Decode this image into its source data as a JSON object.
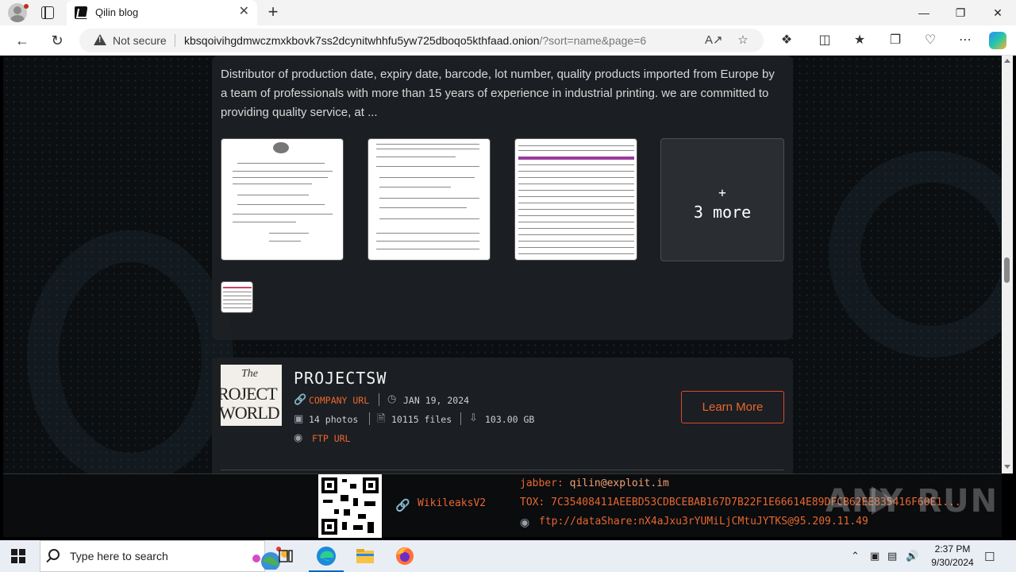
{
  "browser": {
    "tab_title": "Qilin blog",
    "security_label": "Not secure",
    "url_host": "kbsqoivihgdmwczmxkbovk7ss2dcynitwhhfu5yw725dboqo5kthfaad.onion",
    "url_rest": "/?sort=name&page=6",
    "tab_close": "✕",
    "newtab": "+",
    "window": {
      "minimize": "—",
      "maximize": "❐",
      "close": "✕"
    }
  },
  "post_previous": {
    "description": "Distributor of production date, expiry date, barcode, lot number, quality products imported from Europe by a team of professionals with more than 15 years of experience in industrial printing. we are committed to providing quality service, at ...",
    "more_plus": "+",
    "more_label": "3 more"
  },
  "post": {
    "logo_the": "The",
    "logo_line1": "ROJECT",
    "logo_line2": "WORLD",
    "company": "PROJECTSW",
    "company_url_label": "COMPANY URL",
    "date": "JAN 19, 2024",
    "photos": "14 photos",
    "files": "10115 files",
    "size": "103.00 GB",
    "ftp_label": "FTP URL",
    "learn_more": "Learn More"
  },
  "footer": {
    "wikileaks": "WikileaksV2",
    "jabber_label": "jabber:",
    "jabber_value": "qilin@exploit.im",
    "tox_label": "TOX:",
    "tox_value": "7C35408411AEEBD53CDBCEBAB167D7B22F1E66614E89DFCB62EE835416F60E1...",
    "ftp_value": "ftp://dataShare:nX4aJxu3rYUMiLjCMtuJYTKS@95.209.11.49"
  },
  "watermark": "ANY RUN",
  "taskbar": {
    "search_placeholder": "Type here to search",
    "time": "2:37 PM",
    "date": "9/30/2024"
  },
  "colors": {
    "accent": "#e8672f",
    "card": "#1e2124",
    "background": "#0b0f12"
  }
}
